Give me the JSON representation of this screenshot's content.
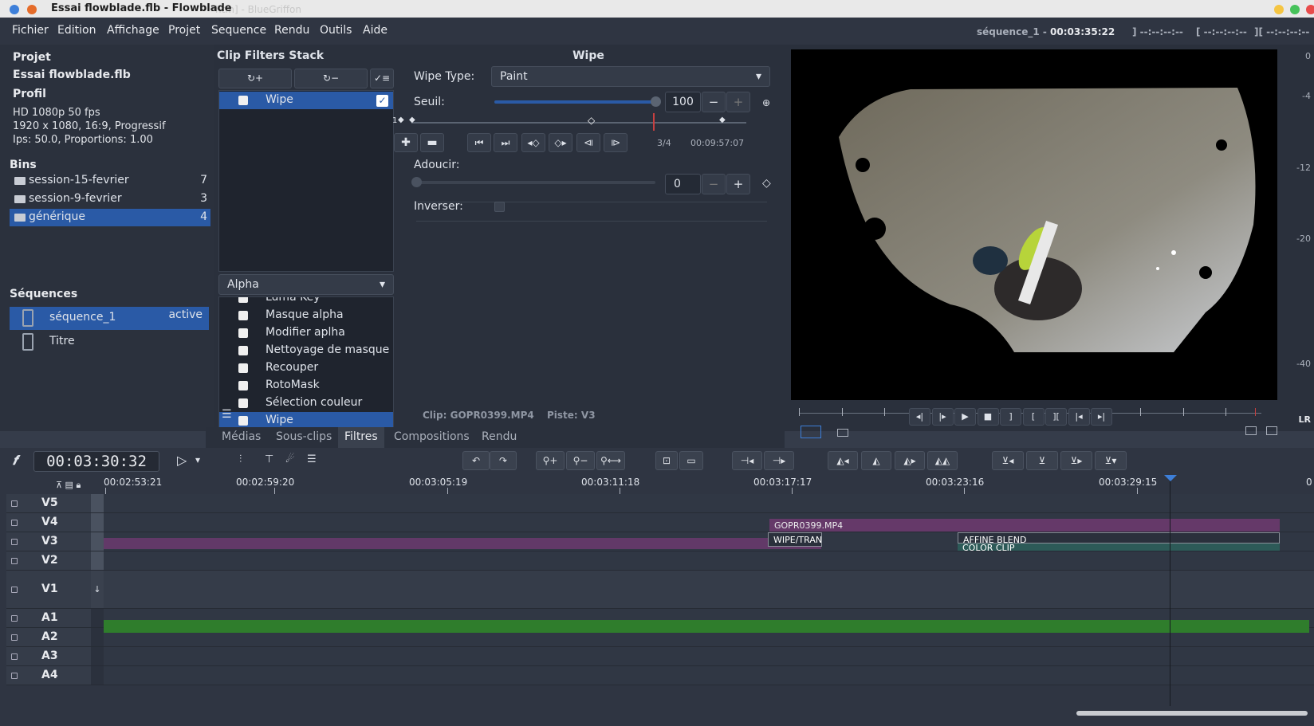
{
  "window": {
    "title": "Essai flowblade.flb - Flowblade",
    "ghost_title": "htm] - BlueGriffon"
  },
  "menu": [
    "Fichier",
    "Edition",
    "Affichage",
    "Projet",
    "Sequence",
    "Rendu",
    "Outils",
    "Aide"
  ],
  "status": {
    "sequence_name": "séquence_1",
    "separator": " - ",
    "timecode": "00:03:35:22",
    "mark_in": "] --:--:--:--",
    "mark_out": "[ --:--:--:--",
    "mark_dur": "][ --:--:--:--"
  },
  "project": {
    "project_heading": "Projet",
    "project_name": "Essai flowblade.flb",
    "profile_heading": "Profil",
    "profile_lines": [
      "HD 1080p 50 fps",
      "1920 x 1080, 16:9, Progressif",
      "Ips: 50.0, Proportions: 1.00"
    ],
    "bins_heading": "Bins",
    "bins": [
      {
        "name": "session-15-fevrier",
        "count": "7"
      },
      {
        "name": "session-9-fevrier",
        "count": "3"
      },
      {
        "name": "générique",
        "count": "4"
      }
    ],
    "sequences_heading": "Séquences",
    "sequences": [
      {
        "name": "séquence_1",
        "status": "active"
      },
      {
        "name": "Titre",
        "status": ""
      }
    ]
  },
  "filters": {
    "stack_title": "Clip Filters Stack",
    "stack_buttons": [
      "↻+",
      "↻−",
      "✓≡"
    ],
    "stack_items": [
      {
        "name": "Wipe",
        "enabled": true
      }
    ],
    "group_select": "Alpha",
    "group_items": [
      "Luma Key",
      "Masque alpha",
      "Modifier aplha",
      "Nettoyage de masque",
      "Recouper",
      "RotoMask",
      "Sélection couleur",
      "Wipe"
    ],
    "selected_group_item": "Wipe",
    "menu_icon": "hamburger-icon"
  },
  "editor": {
    "title": "Wipe",
    "wipe_type_label": "Wipe Type:",
    "wipe_type_value": "Paint",
    "seuil_label": "Seuil:",
    "seuil_value": "100",
    "seuil_fraction": 1.0,
    "kf_start_label": "1",
    "kf_index": "3/4",
    "kf_time": "00:09:57:07",
    "adoucir_label": "Adoucir:",
    "adoucir_value": "0",
    "adoucir_fraction": 0.0,
    "inverser_label": "Inverser:",
    "clip_info": "Clip: GOPR0399.MP4",
    "track_info": "Piste: V3"
  },
  "meter_labels": [
    "0",
    "-4",
    "-12",
    "-20",
    "-40"
  ],
  "meter_lr": "LR",
  "tabs": [
    {
      "label": "Médias"
    },
    {
      "label": "Sous-clips"
    },
    {
      "label": "Filtres",
      "selected": true
    },
    {
      "label": "Compositions"
    },
    {
      "label": "Rendu"
    }
  ],
  "timeline_toolbar": {
    "timecode": "00:03:30:32"
  },
  "ruler": [
    "00:02:53:21",
    "00:02:59:20",
    "00:03:05:19",
    "00:03:11:18",
    "00:03:17:17",
    "00:03:23:16",
    "00:03:29:15"
  ],
  "ruler_end": "0",
  "tracks": [
    "V5",
    "V4",
    "V3",
    "V2",
    "V1",
    "A1",
    "A2",
    "A3",
    "A4"
  ],
  "clips": {
    "v3_clip": "GOPR0399.MP4",
    "wipe": "WIPE/TRAN",
    "affine": "AFFINE BLEND",
    "color": "COLOR CLIP"
  },
  "colors": {
    "accent": "#2a5aa6",
    "video_clip": "#6b3a6e",
    "audio_clip": "#2f7d2c",
    "playhead": "#c84040"
  }
}
